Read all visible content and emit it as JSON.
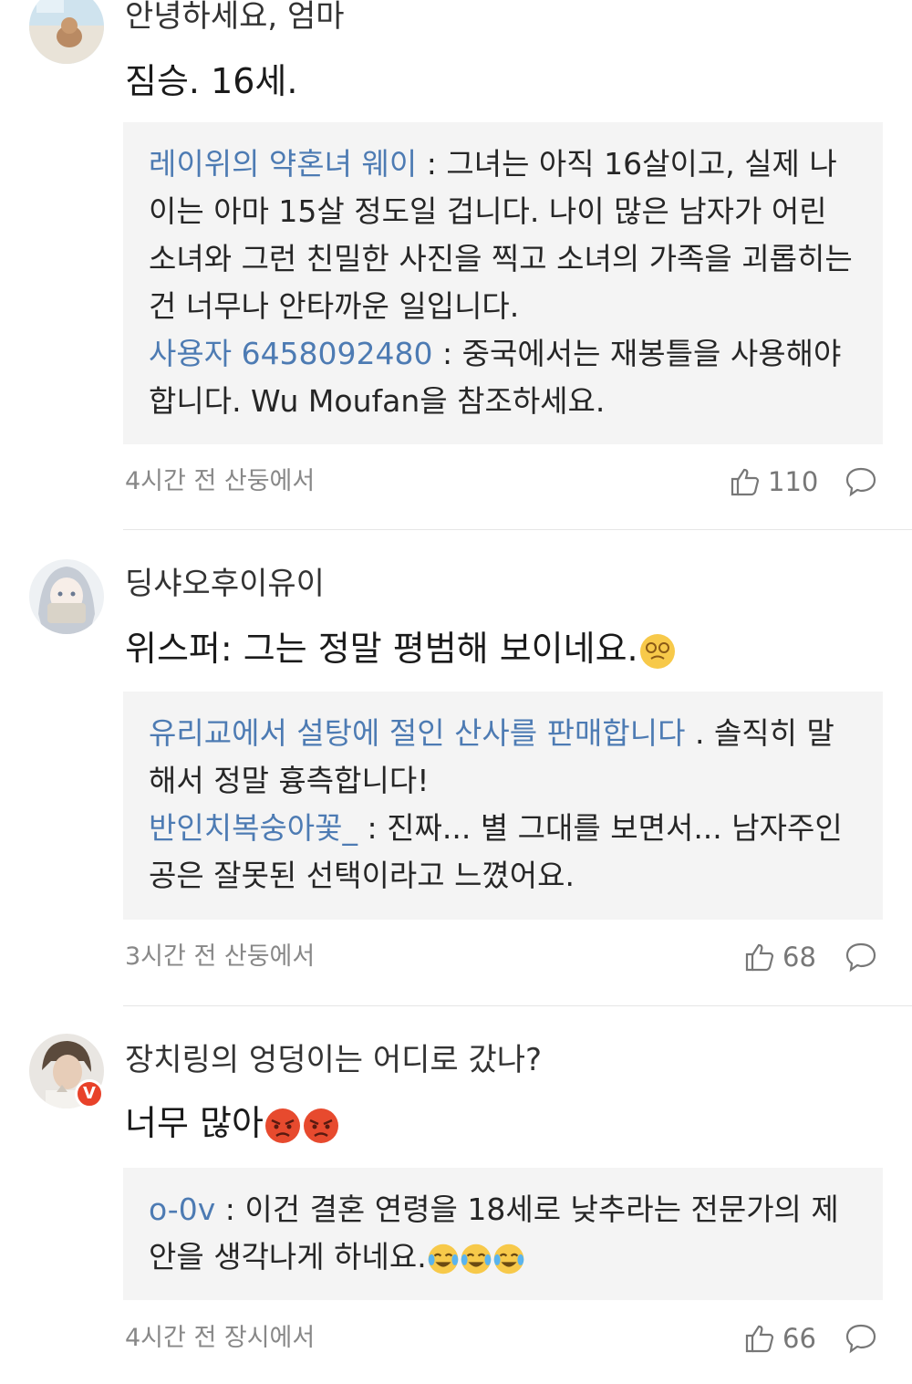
{
  "comments": [
    {
      "username": "안녕하세요, 엄마",
      "body": "짐승. 16세.",
      "replies": [
        {
          "author": "레이위의 약혼녀 웨이",
          "sep": " : ",
          "text": "그녀는 아직 16살이고, 실제 나이는 아마 15살 정도일 겁니다. 나이 많은 남자가 어린 소녀와 그런 친밀한 사진을 찍고 소녀의 가족을 괴롭히는 건 너무나 안타까운 일입니다."
        },
        {
          "author": "사용자 6458092480",
          "sep": " : ",
          "text": "중국에서는 재봉틀을 사용해야 합니다. Wu Moufan을 참조하세요."
        }
      ],
      "meta": "4시간 전 산둥에서",
      "likes": "110"
    },
    {
      "username": "딩샤오후이유이",
      "body": "위스퍼: 그는 정말 평범해 보이네요.",
      "replies": [
        {
          "author": "유리교에서 설탕에 절인 산사를 판매합니다",
          "sep": " . ",
          "text": "솔직히 말해서 정말 흉측합니다!"
        },
        {
          "author": "반인치복숭아꽃_",
          "sep": " : ",
          "text": "진짜... 별 그대를 보면서... 남자주인공은 잘못된 선택이라고 느꼈어요."
        }
      ],
      "meta": "3시간 전 산둥에서",
      "likes": "68"
    },
    {
      "username": "장치링의 엉덩이는 어디로 갔나?",
      "body": "너무 많아",
      "replies": [
        {
          "author": "o-0v",
          "sep": " : ",
          "text": "이건 결혼 연령을 18세로 낮추라는 전문가의 제안을 생각나게 하네요."
        }
      ],
      "meta": "4시간 전 장시에서",
      "likes": "66"
    }
  ],
  "icons": {
    "like": "thumbs-up-icon",
    "reply": "speech-bubble-icon",
    "verified": "verified-v-badge"
  },
  "colors": {
    "author_link": "#4d7bb3",
    "reply_bg": "#f4f4f4",
    "meta": "#888888",
    "badge": "#e8422a"
  }
}
